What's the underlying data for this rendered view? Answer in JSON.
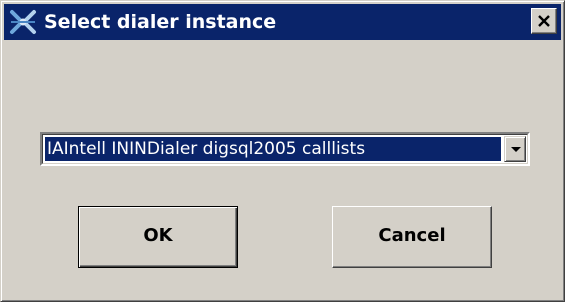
{
  "window": {
    "title": "Select dialer instance",
    "app_icon": "dialer-app-icon",
    "close_icon": "close-icon"
  },
  "dialer_select": {
    "selected_value": "IAIntell ININDialer digsql2005 calllists",
    "arrow_icon": "dropdown-arrow-icon"
  },
  "buttons": {
    "ok_label": "OK",
    "cancel_label": "Cancel"
  },
  "colors": {
    "titlebar": "#0a246a",
    "dialog_face": "#d4d0c8",
    "selection_highlight": "#0a246a"
  }
}
